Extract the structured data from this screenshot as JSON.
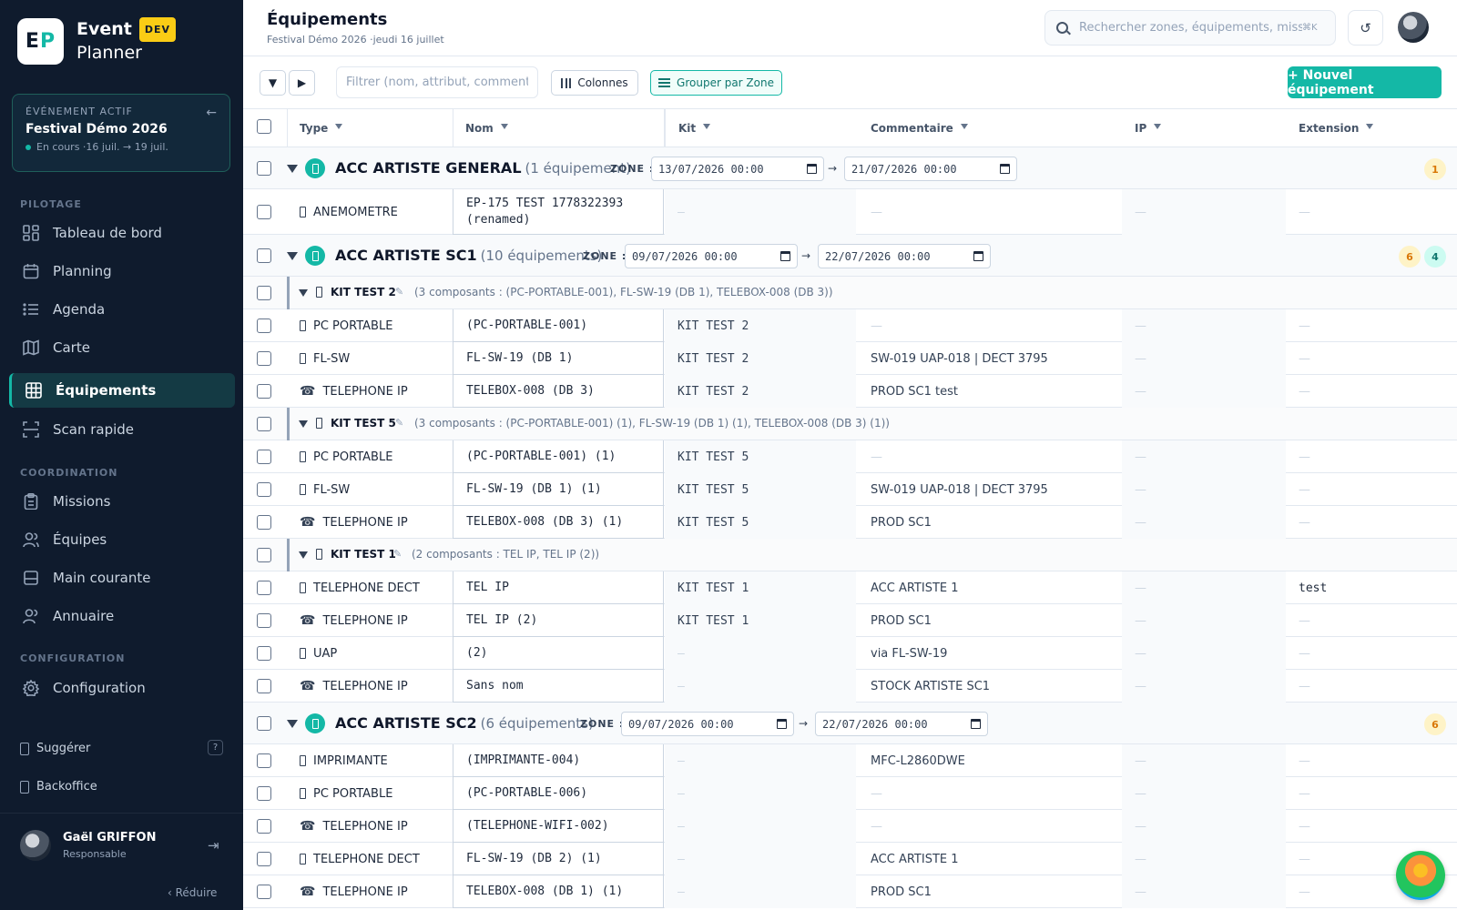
{
  "brand": {
    "logo_e": "E",
    "logo_p": "P",
    "name": "Event",
    "tag": "DEV",
    "name2": "Planner"
  },
  "event": {
    "kicker": "ÉVÉNEMENT ACTIF",
    "title": "Festival Démo 2026",
    "status": "En cours",
    "dates": "·16 juil. → 19 juil."
  },
  "nav": {
    "section_pilotage": "PILOTAGE",
    "section_coordination": "COORDINATION",
    "section_configuration": "CONFIGURATION",
    "items": [
      {
        "label": "Tableau de bord",
        "icon": "dashboard-icon"
      },
      {
        "label": "Planning",
        "icon": "calendar-icon"
      },
      {
        "label": "Agenda",
        "icon": "list-icon"
      },
      {
        "label": "Carte",
        "icon": "map-icon"
      },
      {
        "label": "Équipements",
        "icon": "grid-icon"
      },
      {
        "label": "Scan rapide",
        "icon": "scan-icon"
      },
      {
        "label": "Missions",
        "icon": "clipboard-icon"
      },
      {
        "label": "Équipes",
        "icon": "users-icon"
      },
      {
        "label": "Main courante",
        "icon": "log-icon"
      },
      {
        "label": "Annuaire",
        "icon": "contacts-icon"
      },
      {
        "label": "Configuration",
        "icon": "gear-icon"
      }
    ],
    "suggest": "Suggérer",
    "help": "?",
    "backoffice": "Backoffice"
  },
  "user": {
    "name": "Gaël GRIFFON",
    "role": "Responsable",
    "reduce": "‹  Réduire"
  },
  "header": {
    "title": "Équipements",
    "subtitle": "Festival Démo 2026 ·jeudi 16 juillet",
    "search_placeholder": "Rechercher zones, équipements, missi",
    "search_kbd": "⌘K",
    "refresh": "↺"
  },
  "toolbar": {
    "collapse": "▼",
    "expand": "▶",
    "filter_placeholder": "Filtrer (nom, attribut, commentair",
    "columns": "Colonnes",
    "group": "Grouper par Zone",
    "new": "+ Nouvel équipement"
  },
  "columns": {
    "type": "Type",
    "nom": "Nom",
    "kit": "Kit",
    "comment": "Commentaire",
    "ip": "IP",
    "ext": "Extension"
  },
  "zone_label": "ZONE :",
  "arrow": "→",
  "dash": "—",
  "zones": [
    {
      "name": "ACC ARTISTE GENERAL",
      "count": "(1 équipement)",
      "from": "13/07/2026 00:00",
      "to": "21/07/2026 00:00",
      "badges": [
        "1"
      ]
    },
    {
      "name": "ACC ARTISTE SC1",
      "count": "(10 équipements)",
      "from": "09/07/2026 00:00",
      "to": "22/07/2026 00:00",
      "badges": [
        "6",
        "4"
      ]
    },
    {
      "name": "ACC ARTISTE SC2",
      "count": "(6 équipements)",
      "from": "09/07/2026 00:00",
      "to": "22/07/2026 00:00",
      "badges": [
        "6"
      ]
    }
  ],
  "kits": [
    {
      "name": "KIT TEST 2",
      "desc": "(3 composants : (PC-PORTABLE-001), FL-SW-19 (DB 1), TELEBOX-008 (DB 3))"
    },
    {
      "name": "KIT TEST 5",
      "desc": "(3 composants : (PC-PORTABLE-001) (1), FL-SW-19 (DB 1) (1), TELEBOX-008 (DB 3) (1))"
    },
    {
      "name": "KIT TEST 1",
      "desc": "(2 composants : TEL IP, TEL IP (2))"
    }
  ],
  "rows": {
    "r0": {
      "type": "ANEMOMETRE",
      "nom": "EP-175 TEST 1778322393 (renamed)",
      "kit": "",
      "comment": "",
      "ext": ""
    },
    "r1": {
      "type": "PC PORTABLE",
      "nom": "(PC-PORTABLE-001)",
      "kit": "KIT TEST 2",
      "comment": "",
      "ext": ""
    },
    "r2": {
      "type": "FL-SW",
      "nom": "FL-SW-19 (DB 1)",
      "kit": "KIT TEST 2",
      "comment": "SW-019 UAP-018 | DECT 3795",
      "ext": ""
    },
    "r3": {
      "type": "TELEPHONE IP",
      "nom": "TELEBOX-008 (DB 3)",
      "kit": "KIT TEST 2",
      "comment": "PROD SC1 test",
      "ext": ""
    },
    "r4": {
      "type": "PC PORTABLE",
      "nom": "(PC-PORTABLE-001) (1)",
      "kit": "KIT TEST 5",
      "comment": "",
      "ext": ""
    },
    "r5": {
      "type": "FL-SW",
      "nom": "FL-SW-19 (DB 1) (1)",
      "kit": "KIT TEST 5",
      "comment": "SW-019 UAP-018 | DECT 3795",
      "ext": ""
    },
    "r6": {
      "type": "TELEPHONE IP",
      "nom": "TELEBOX-008 (DB 3) (1)",
      "kit": "KIT TEST 5",
      "comment": "PROD SC1",
      "ext": ""
    },
    "r7": {
      "type": "TELEPHONE DECT",
      "nom": "TEL IP",
      "kit": "KIT TEST 1",
      "comment": "ACC ARTISTE 1",
      "ext": "test"
    },
    "r8": {
      "type": "TELEPHONE IP",
      "nom": "TEL IP (2)",
      "kit": "KIT TEST 1",
      "comment": "PROD SC1",
      "ext": ""
    },
    "r9": {
      "type": "UAP",
      "nom": "(2)",
      "kit": "",
      "comment": "via FL-SW-19",
      "ext": ""
    },
    "r10": {
      "type": "TELEPHONE IP",
      "nom": "Sans nom",
      "kit": "",
      "comment": "STOCK ARTISTE SC1",
      "ext": ""
    },
    "r11": {
      "type": "IMPRIMANTE",
      "nom": "(IMPRIMANTE-004)",
      "kit": "",
      "comment": "MFC-L2860DWE",
      "ext": ""
    },
    "r12": {
      "type": "PC PORTABLE",
      "nom": "(PC-PORTABLE-006)",
      "kit": "",
      "comment": "",
      "ext": ""
    },
    "r13": {
      "type": "TELEPHONE IP",
      "nom": "(TELEPHONE-WIFI-002)",
      "kit": "",
      "comment": "",
      "ext": ""
    },
    "r14": {
      "type": "TELEPHONE DECT",
      "nom": "FL-SW-19 (DB 2) (1)",
      "kit": "",
      "comment": "ACC ARTISTE 1",
      "ext": ""
    },
    "r15": {
      "type": "TELEPHONE IP",
      "nom": "TELEBOX-008 (DB 1) (1)",
      "kit": "",
      "comment": "PROD SC1",
      "ext": ""
    }
  },
  "colors": {
    "sidebar": "#0f1b2d",
    "accent": "#14b8a6",
    "dev_badge": "#facc15",
    "badge_orange": "#d97706"
  }
}
